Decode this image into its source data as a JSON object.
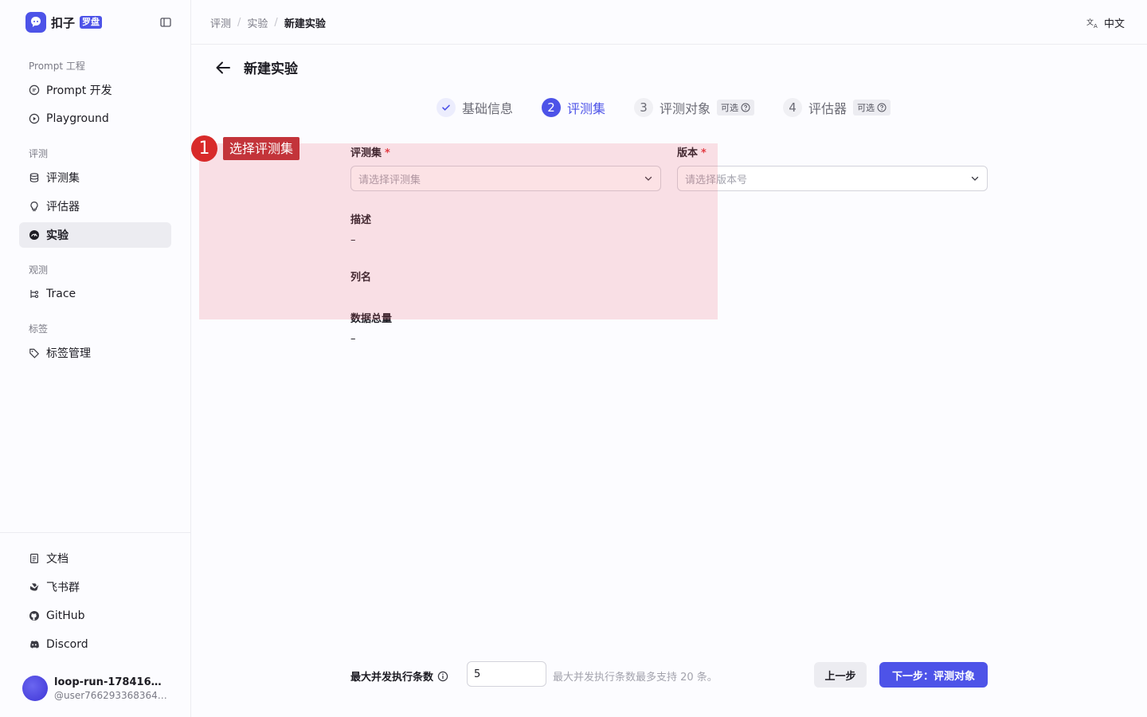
{
  "app": {
    "brand_name": "扣子",
    "brand_tag": "罗盘"
  },
  "sidebar": {
    "groups": [
      {
        "title": "Prompt 工程",
        "items": [
          {
            "label": "Prompt 开发",
            "icon": "chat-bubble-icon"
          },
          {
            "label": "Playground",
            "icon": "play-circle-icon"
          }
        ]
      },
      {
        "title": "评测",
        "items": [
          {
            "label": "评测集",
            "icon": "database-icon"
          },
          {
            "label": "评估器",
            "icon": "lightbulb-icon"
          },
          {
            "label": "实验",
            "icon": "gauge-icon",
            "active": true
          }
        ]
      },
      {
        "title": "观测",
        "items": [
          {
            "label": "Trace",
            "icon": "trace-icon"
          }
        ]
      },
      {
        "title": "标签",
        "items": [
          {
            "label": "标签管理",
            "icon": "tag-icon"
          }
        ]
      }
    ],
    "bottom_items": [
      {
        "label": "文档",
        "icon": "document-icon"
      },
      {
        "label": "飞书群",
        "icon": "feishu-icon"
      },
      {
        "label": "GitHub",
        "icon": "github-icon"
      },
      {
        "label": "Discord",
        "icon": "discord-icon"
      }
    ],
    "user": {
      "name": "loop-run-178416577…",
      "handle": "@user7662933683648…"
    }
  },
  "header": {
    "breadcrumb": [
      "评测",
      "实验",
      "新建实验"
    ],
    "language": "中文"
  },
  "page": {
    "title": "新建实验",
    "steps": [
      {
        "number": "1",
        "label": "基础信息",
        "state": "done"
      },
      {
        "number": "2",
        "label": "评测集",
        "state": "active"
      },
      {
        "number": "3",
        "label": "评测对象",
        "state": "todo",
        "optional_tag": "可选"
      },
      {
        "number": "4",
        "label": "评估器",
        "state": "todo",
        "optional_tag": "可选"
      }
    ]
  },
  "annotation": {
    "number": "1",
    "label": "选择评测集"
  },
  "form": {
    "dataset_label": "评测集",
    "dataset_placeholder": "请选择评测集",
    "version_label": "版本",
    "version_placeholder": "请选择版本号",
    "required_mark": "*",
    "description_label": "描述",
    "description_value": "–",
    "columns_label": "列名",
    "total_label": "数据总量",
    "total_value": "–"
  },
  "footer": {
    "concurrency_label": "最大并发执行条数",
    "concurrency_value": "5",
    "concurrency_hint": "最大并发执行条数最多支持 20 条。",
    "prev_button": "上一步",
    "next_button": "下一步：评测对象"
  },
  "colors": {
    "accent": "#4d53e8",
    "overlay": "#ec5d6f",
    "annotation_badge": "#d82a2a",
    "required": "#e0363b"
  }
}
